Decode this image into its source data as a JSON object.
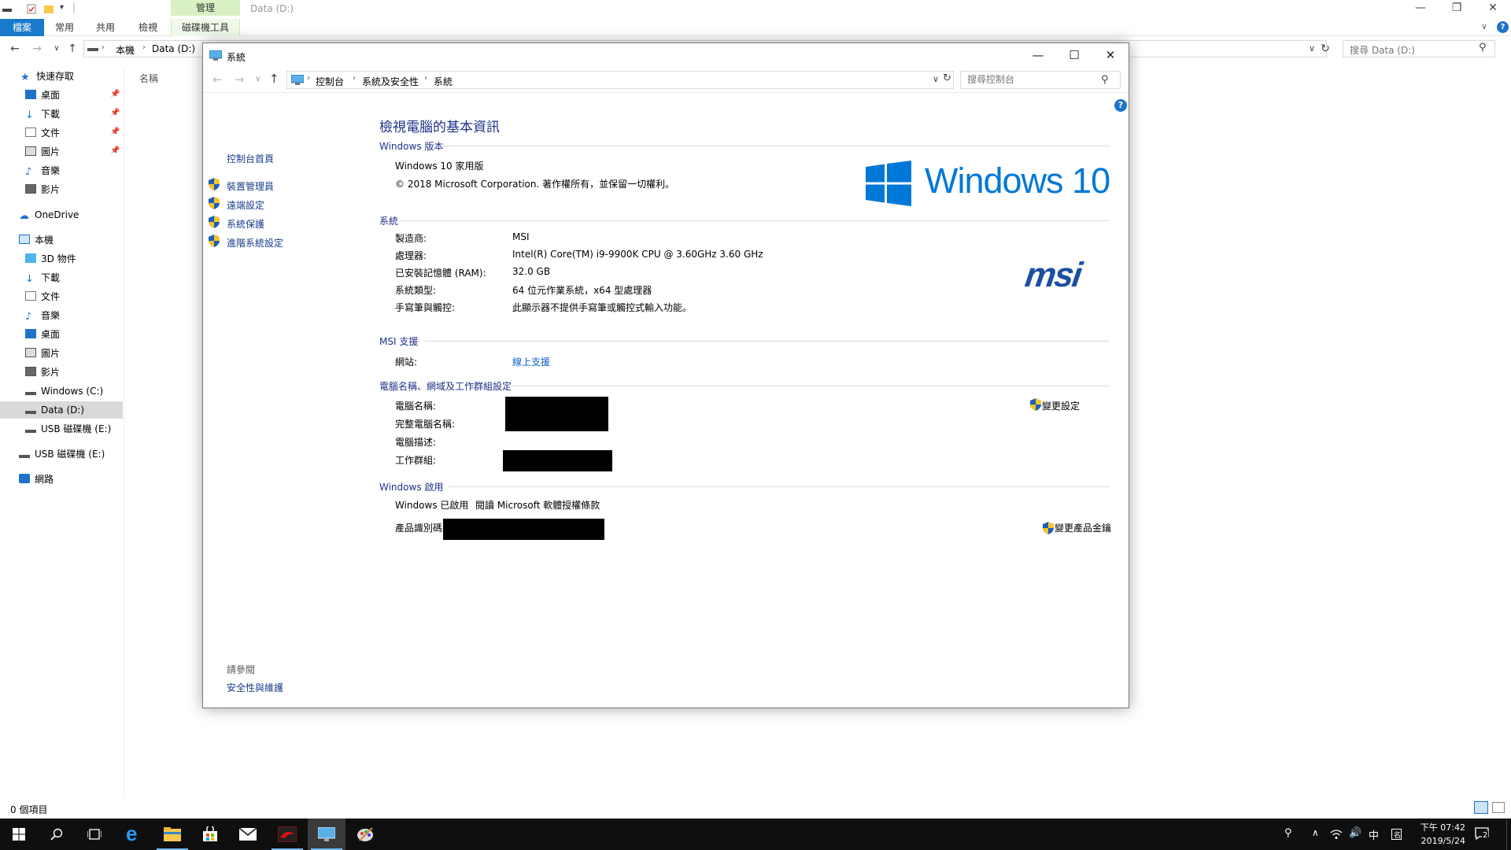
{
  "explorer": {
    "window_title": "Data (D:)",
    "context_tab_group": "管理",
    "ribbon_tabs": [
      "檔案",
      "常用",
      "共用",
      "檢視",
      "磁碟機工具"
    ],
    "breadcrumb": [
      "本機",
      "Data (D:)"
    ],
    "search_placeholder": "搜尋 Data (D:)",
    "column_header": "名稱",
    "sidebar": {
      "quick_access": "快速存取",
      "quick_items": [
        "桌面",
        "下載",
        "文件",
        "圖片",
        "音樂",
        "影片"
      ],
      "onedrive": "OneDrive",
      "this_pc": "本機",
      "pc_items": [
        "3D 物件",
        "下載",
        "文件",
        "音樂",
        "桌面",
        "圖片",
        "影片",
        "Windows (C:)",
        "Data (D:)",
        "USB 磁碟機 (E:)"
      ],
      "usb": "USB 磁碟機 (E:)",
      "network": "網路"
    },
    "status": "0 個項目"
  },
  "system_window": {
    "title": "系統",
    "breadcrumb": [
      "控制台",
      "系統及安全性",
      "系統"
    ],
    "search_placeholder": "搜尋控制台",
    "left_pane": {
      "home": "控制台首頁",
      "links": [
        "裝置管理員",
        "遠端設定",
        "系統保護",
        "進階系統設定"
      ],
      "see_also_label": "請參閱",
      "see_also_link": "安全性與維護"
    },
    "heading": "檢視電腦的基本資訊",
    "windows_edition": {
      "section": "Windows 版本",
      "edition": "Windows 10 家用版",
      "copyright": "© 2018 Microsoft Corporation. 著作權所有，並保留一切權利。",
      "logo_text": "Windows 10"
    },
    "system": {
      "section": "系統",
      "rows": [
        {
          "label": "製造商:",
          "value": "MSI"
        },
        {
          "label": "處理器:",
          "value": "Intel(R) Core(TM) i9-9900K CPU @ 3.60GHz   3.60 GHz"
        },
        {
          "label": "已安裝記憶體 (RAM):",
          "value": "32.0 GB"
        },
        {
          "label": "系統類型:",
          "value": "64 位元作業系統，x64 型處理器"
        },
        {
          "label": "手寫筆與觸控:",
          "value": "此顯示器不提供手寫筆或觸控式輸入功能。"
        }
      ],
      "oem_logo": "msi"
    },
    "support": {
      "section": "MSI 支援",
      "label": "網站:",
      "link": "線上支援"
    },
    "computer_name": {
      "section": "電腦名稱、網域及工作群組設定",
      "labels": [
        "電腦名稱:",
        "完整電腦名稱:",
        "電腦描述:",
        "工作群組:"
      ],
      "change_link": "變更設定"
    },
    "activation": {
      "section": "Windows 啟用",
      "status": "Windows 已啟用",
      "license_link": "閱讀 Microsoft 軟體授權條款",
      "product_id_label": "產品識別碼",
      "change_key_link": "變更產品金鑰"
    }
  },
  "taskbar": {
    "ime": "中",
    "time": "下午 07:42",
    "date": "2019/5/24",
    "notification_count": "2"
  },
  "colors": {
    "accent": "#1979ca",
    "link": "#0a64c8",
    "heading": "#1e3287",
    "windows_logo": "#0078d7",
    "msi_logo": "#1c4fa3"
  }
}
